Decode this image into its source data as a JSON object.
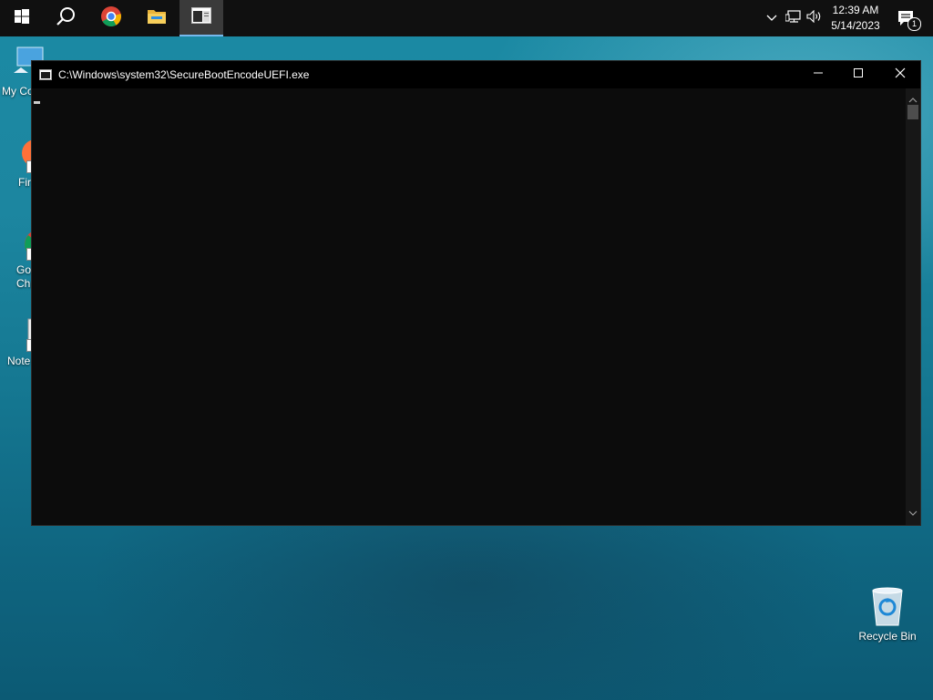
{
  "taskbar": {
    "start": "start-icon",
    "search": "search-icon",
    "pinned": [
      {
        "name": "Google Chrome",
        "icon": "chrome-icon"
      },
      {
        "name": "File Explorer",
        "icon": "folder-icon"
      },
      {
        "name": "Console",
        "icon": "console-icon",
        "active": true
      }
    ],
    "tray": {
      "icons": [
        "chevron-up-icon",
        "network-icon",
        "volume-icon"
      ],
      "time": "12:39 AM",
      "date": "5/14/2023",
      "notification_count": "1"
    }
  },
  "desktop": {
    "icons": [
      {
        "label": "My Co"
      },
      {
        "label": "Fir"
      },
      {
        "label": "Go\nChr"
      },
      {
        "label": "Note"
      },
      {
        "label": "Recycle Bin"
      }
    ]
  },
  "window": {
    "title": "C:\\Windows\\system32\\SecureBootEncodeUEFI.exe",
    "controls": [
      "minimize-icon",
      "maximize-icon",
      "close-icon"
    ],
    "console_text": ""
  },
  "colors": {
    "taskbar": "#101010",
    "console_bg": "#0c0c0c",
    "accent": "#76b9ed"
  }
}
